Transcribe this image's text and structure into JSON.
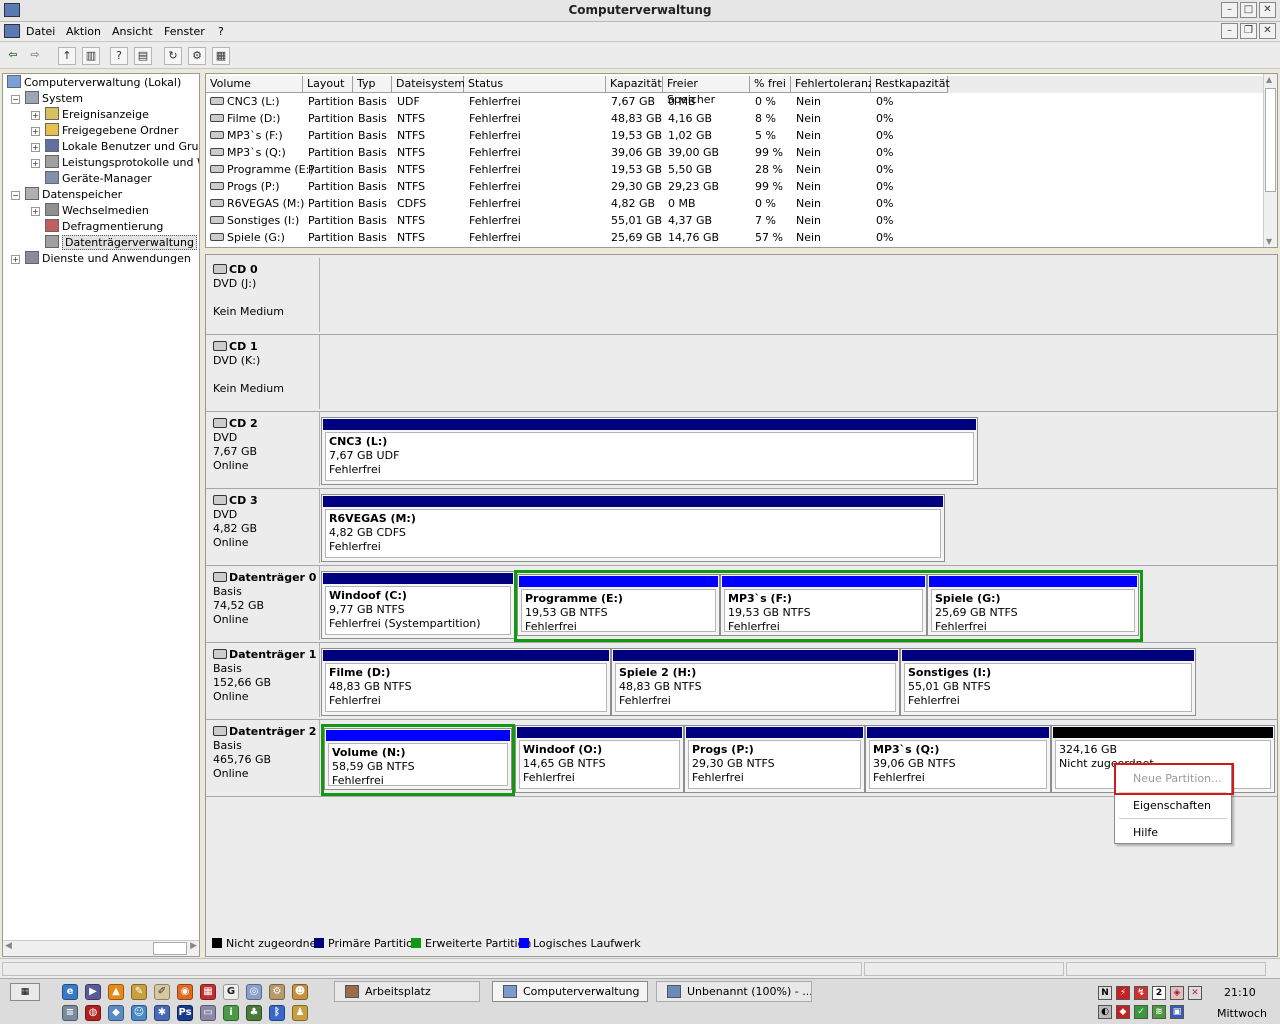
{
  "window": {
    "title": "Computerverwaltung"
  },
  "menu": [
    "Datei",
    "Aktion",
    "Ansicht",
    "Fenster",
    "?"
  ],
  "tree": {
    "root": "Computerverwaltung (Lokal)",
    "system": "System",
    "system_items": [
      "Ereignisanzeige",
      "Freigegebene Ordner",
      "Lokale Benutzer und Gruppe",
      "Leistungsprotokolle und Wa",
      "Geräte-Manager"
    ],
    "storage": "Datenspeicher",
    "storage_items": [
      "Wechselmedien",
      "Defragmentierung",
      "Datenträgerverwaltung"
    ],
    "services": "Dienste und Anwendungen"
  },
  "volume_table": {
    "headers": [
      "Volume",
      "Layout",
      "Typ",
      "Dateisystem",
      "Status",
      "Kapazität",
      "Freier Speicher",
      "% frei",
      "Fehlertoleranz",
      "Restkapazität"
    ],
    "rows": [
      [
        "CNC3  (L:)",
        "Partition",
        "Basis",
        "UDF",
        "Fehlerfrei",
        "7,67 GB",
        "0 MB",
        "0 %",
        "Nein",
        "0%"
      ],
      [
        "Filme  (D:)",
        "Partition",
        "Basis",
        "NTFS",
        "Fehlerfrei",
        "48,83 GB",
        "4,16 GB",
        "8 %",
        "Nein",
        "0%"
      ],
      [
        "MP3`s  (F:)",
        "Partition",
        "Basis",
        "NTFS",
        "Fehlerfrei",
        "19,53 GB",
        "1,02 GB",
        "5 %",
        "Nein",
        "0%"
      ],
      [
        "MP3`s  (Q:)",
        "Partition",
        "Basis",
        "NTFS",
        "Fehlerfrei",
        "39,06 GB",
        "39,00 GB",
        "99 %",
        "Nein",
        "0%"
      ],
      [
        "Programme  (E:)",
        "Partition",
        "Basis",
        "NTFS",
        "Fehlerfrei",
        "19,53 GB",
        "5,50 GB",
        "28 %",
        "Nein",
        "0%"
      ],
      [
        "Progs  (P:)",
        "Partition",
        "Basis",
        "NTFS",
        "Fehlerfrei",
        "29,30 GB",
        "29,23 GB",
        "99 %",
        "Nein",
        "0%"
      ],
      [
        "R6VEGAS  (M:)",
        "Partition",
        "Basis",
        "CDFS",
        "Fehlerfrei",
        "4,82 GB",
        "0 MB",
        "0 %",
        "Nein",
        "0%"
      ],
      [
        "Sonstiges  (I:)",
        "Partition",
        "Basis",
        "NTFS",
        "Fehlerfrei",
        "55,01 GB",
        "4,37 GB",
        "7 %",
        "Nein",
        "0%"
      ],
      [
        "Spiele  (G:)",
        "Partition",
        "Basis",
        "NTFS",
        "Fehlerfrei",
        "25,69 GB",
        "14,76 GB",
        "57 %",
        "Nein",
        "0%"
      ]
    ]
  },
  "disks": [
    {
      "name": "CD 0",
      "l1": "DVD (J:)",
      "l2": "",
      "l3": "Kein Medium"
    },
    {
      "name": "CD 1",
      "l1": "DVD (K:)",
      "l2": "",
      "l3": "Kein Medium"
    },
    {
      "name": "CD 2",
      "l1": "DVD",
      "l2": "7,67 GB",
      "l3": "Online"
    },
    {
      "name": "CD 3",
      "l1": "DVD",
      "l2": "4,82 GB",
      "l3": "Online"
    },
    {
      "name": "Datenträger 0",
      "l1": "Basis",
      "l2": "74,52 GB",
      "l3": "Online"
    },
    {
      "name": "Datenträger 1",
      "l1": "Basis",
      "l2": "152,66 GB",
      "l3": "Online"
    },
    {
      "name": "Datenträger 2",
      "l1": "Basis",
      "l2": "465,76 GB",
      "l3": "Online"
    }
  ],
  "partitions": {
    "cd2": [
      {
        "t": "CNC3  (L:)",
        "s": "7,67 GB UDF",
        "st": "Fehlerfrei"
      }
    ],
    "cd3": [
      {
        "t": "R6VEGAS  (M:)",
        "s": "4,82 GB CDFS",
        "st": "Fehlerfrei"
      }
    ],
    "d0": [
      {
        "t": "Windoof  (C:)",
        "s": "9,77 GB NTFS",
        "st": "Fehlerfrei (Systempartition)"
      },
      {
        "t": "Programme  (E:)",
        "s": "19,53 GB NTFS",
        "st": "Fehlerfrei"
      },
      {
        "t": "MP3`s  (F:)",
        "s": "19,53 GB NTFS",
        "st": "Fehlerfrei"
      },
      {
        "t": "Spiele  (G:)",
        "s": "25,69 GB NTFS",
        "st": "Fehlerfrei"
      }
    ],
    "d1": [
      {
        "t": "Filme  (D:)",
        "s": "48,83 GB NTFS",
        "st": "Fehlerfrei"
      },
      {
        "t": "Spiele 2  (H:)",
        "s": "48,83 GB NTFS",
        "st": "Fehlerfrei"
      },
      {
        "t": "Sonstiges  (I:)",
        "s": "55,01 GB NTFS",
        "st": "Fehlerfrei"
      }
    ],
    "d2": [
      {
        "t": "Volume  (N:)",
        "s": "58,59 GB NTFS",
        "st": "Fehlerfrei"
      },
      {
        "t": "Windoof  (O:)",
        "s": "14,65 GB NTFS",
        "st": "Fehlerfrei"
      },
      {
        "t": "Progs  (P:)",
        "s": "29,30 GB NTFS",
        "st": "Fehlerfrei"
      },
      {
        "t": "MP3`s  (Q:)",
        "s": "39,06 GB NTFS",
        "st": "Fehlerfrei"
      }
    ],
    "d2_unalloc": {
      "s": "324,16 GB",
      "st": "Nicht zugeordnet"
    }
  },
  "legend": [
    "Nicht zugeordnet",
    "Primäre Partition",
    "Erweiterte Partition",
    "Logisches Laufwerk"
  ],
  "colors": {
    "unallocated": "#000000",
    "primary": "#00007f",
    "extended": "#119a11",
    "logical": "#0000ff"
  },
  "context_menu": {
    "new_partition": "Neue Partition...",
    "properties": "Eigenschaften",
    "help": "Hilfe"
  },
  "taskbar": {
    "tasks": [
      "Arbeitsplatz",
      "Computerverwaltung",
      "Unbenannt (100%) - ..."
    ],
    "time": "21:10",
    "day": "Mittwoch",
    "tray_numbers": [
      "2"
    ]
  }
}
